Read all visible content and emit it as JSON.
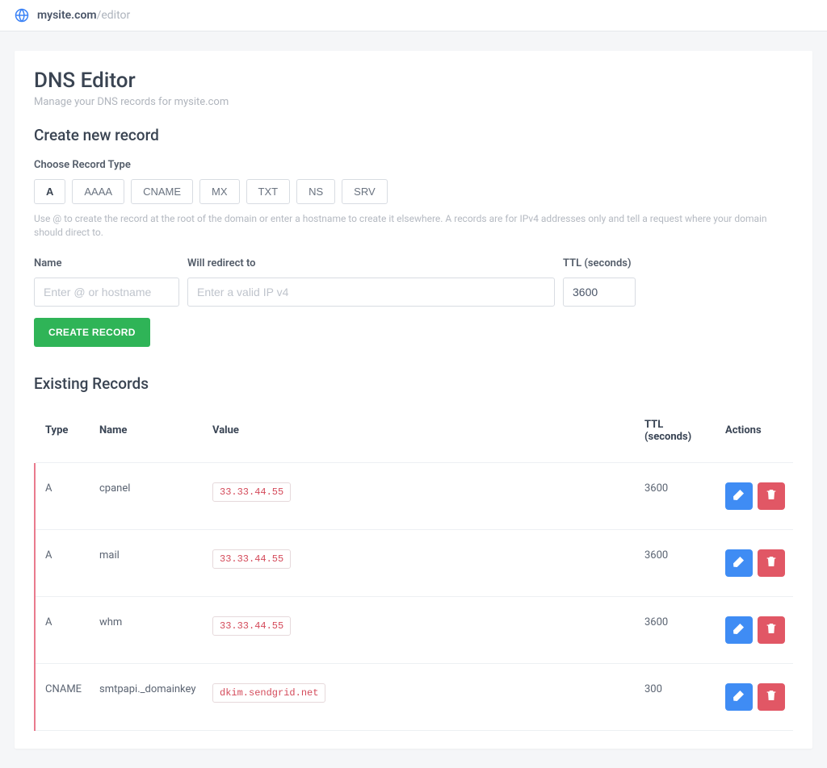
{
  "topbar": {
    "domain": "mysite.com",
    "separator": "/",
    "page": "editor"
  },
  "header": {
    "title": "DNS Editor",
    "subtitle": "Manage your DNS records for mysite.com"
  },
  "create": {
    "section_title": "Create new record",
    "type_label": "Choose Record Type",
    "types": [
      "A",
      "AAAA",
      "CNAME",
      "MX",
      "TXT",
      "NS",
      "SRV"
    ],
    "active_type_index": 0,
    "help": "Use @ to create the record at the root of the domain or enter a hostname to create it elsewhere. A records are for IPv4 addresses only and tell a request where your domain should direct to.",
    "name_label": "Name",
    "name_placeholder": "Enter @ or hostname",
    "value_label": "Will redirect to",
    "value_placeholder": "Enter a valid IP v4",
    "ttl_label": "TTL (seconds)",
    "ttl_value": "3600",
    "submit_label": "CREATE RECORD"
  },
  "existing": {
    "section_title": "Existing Records",
    "columns": {
      "type": "Type",
      "name": "Name",
      "value": "Value",
      "ttl": "TTL (seconds)",
      "actions": "Actions"
    },
    "rows": [
      {
        "type": "A",
        "name": "cpanel",
        "value": "33.33.44.55",
        "ttl": "3600"
      },
      {
        "type": "A",
        "name": "mail",
        "value": "33.33.44.55",
        "ttl": "3600"
      },
      {
        "type": "A",
        "name": "whm",
        "value": "33.33.44.55",
        "ttl": "3600"
      },
      {
        "type": "CNAME",
        "name": "smtpapi._domainkey",
        "value": "dkim.sendgrid.net",
        "ttl": "300"
      }
    ]
  }
}
